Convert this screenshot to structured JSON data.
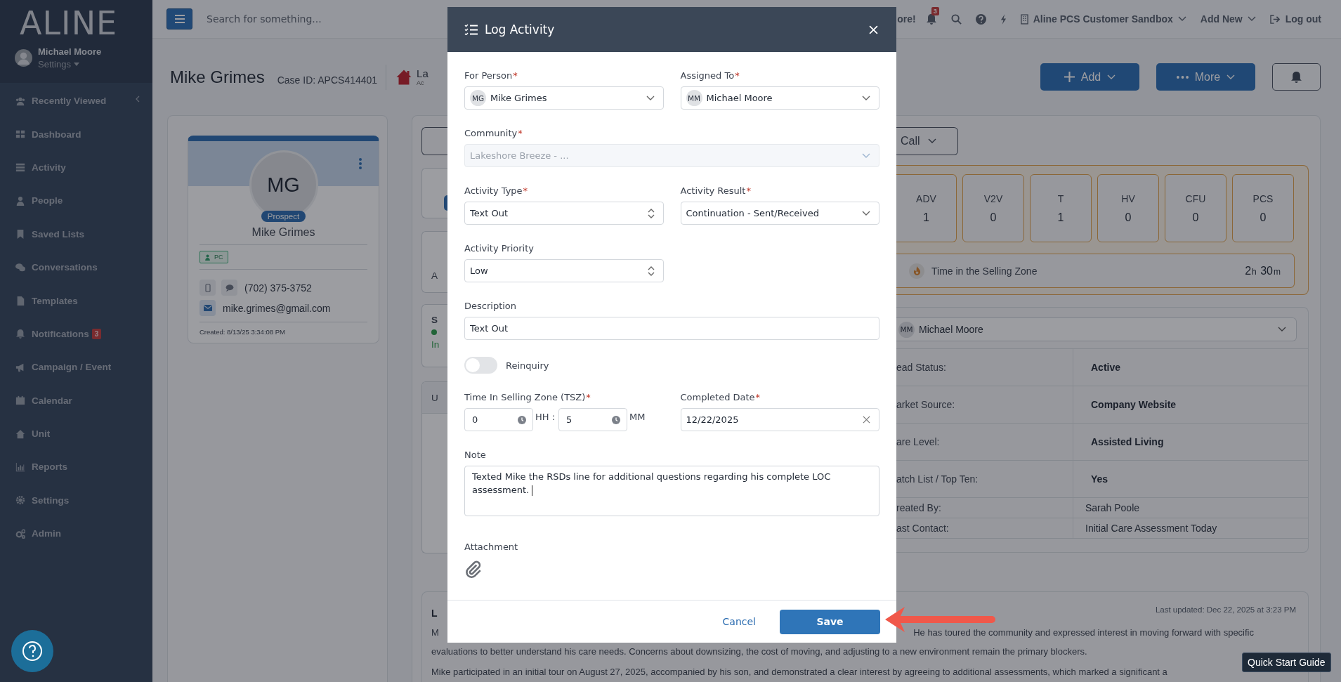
{
  "sidebar": {
    "logo": "ALINE",
    "user": {
      "name": "Michael Moore",
      "settings": "Settings"
    },
    "items": [
      {
        "label": "Recently Viewed"
      },
      {
        "label": "Dashboard"
      },
      {
        "label": "Activity"
      },
      {
        "label": "People"
      },
      {
        "label": "Saved Lists"
      },
      {
        "label": "Conversations"
      },
      {
        "label": "Templates"
      },
      {
        "label": "Notifications",
        "badge": "3"
      },
      {
        "label": "Campaign / Event"
      },
      {
        "label": "Calendar"
      },
      {
        "label": "Unit"
      },
      {
        "label": "Reports"
      },
      {
        "label": "Settings"
      },
      {
        "label": "Admin"
      }
    ]
  },
  "topbar": {
    "search": {
      "placeholder": "Search for something..."
    },
    "promo_fragment": "ore!",
    "notification_badge": "3",
    "account": "Aline PCS Customer Sandbox",
    "add_new": "Add New",
    "logout": "Log out"
  },
  "header": {
    "name": "Mike Grimes",
    "case_id": "Case ID: APCS414401",
    "location_fragment": "La",
    "location_sub_fragment": "Ac",
    "buttons": [
      "Add",
      "More"
    ]
  },
  "profile": {
    "initials": "MG",
    "status": "Prospect",
    "name": "Mike Grimes",
    "tag": "PC",
    "phone": "(702) 375-3752",
    "email": "mike.grimes@gmail.com",
    "created": "Created: 8/13/25 3:34:08 PM"
  },
  "main": {
    "fragments": [
      "A",
      "S",
      "In",
      "U"
    ],
    "call_button": "Call",
    "stats": [
      {
        "label": "ADV",
        "value": "1"
      },
      {
        "label": "V2V",
        "value": "0"
      },
      {
        "label": "T",
        "value": "1"
      },
      {
        "label": "HV",
        "value": "0"
      },
      {
        "label": "CFU",
        "value": "0"
      },
      {
        "label": "PCS",
        "value": "0"
      }
    ],
    "tsz": {
      "label": "Time in the Selling Zone",
      "hours": "2",
      "hours_unit": "h",
      "minutes": "30",
      "minutes_unit": "m"
    },
    "assignee": {
      "initials": "MM",
      "name": "Michael Moore"
    },
    "details": [
      {
        "label": "ead Status:",
        "value": "Active",
        "bold": true
      },
      {
        "label": "arket Source:",
        "value": "Company Website",
        "bold": true
      },
      {
        "label": "are Level:",
        "value": "Assisted Living",
        "bold": true
      },
      {
        "label": "atch List / Top Ten:",
        "value": "Yes",
        "bold": true
      },
      {
        "label": "reated By:",
        "value": "Sarah Poole",
        "bold": false
      },
      {
        "label": "ast Contact:",
        "value": "Initial Care Assessment Today",
        "bold": false
      }
    ],
    "summary": {
      "title_fragment": "L",
      "updated": "Last updated: Dec 22, 2025 at 3:23 PM",
      "line_1_start": "M",
      "line_1_end": "He has toured the community and expressed interest in moving forward with specific",
      "line_2": "evaluations to better understand his care needs. Concerns about downsizing, the cost of moving, and adjusting to a new environment remain the primary blockers.",
      "line_3": "Mike participated in an initial tour on August 27, 2025, accompanied by his son, and demonstrated a clear interest by agreeing to additional assessments, which marked a significant a"
    }
  },
  "modal": {
    "title": "Log Activity",
    "required_mark": "*",
    "for_person": {
      "label": "For Person",
      "required": true,
      "kind": "select",
      "initials": "MG",
      "value": "Mike Grimes"
    },
    "assigned_to": {
      "label": "Assigned To",
      "required": true,
      "kind": "select",
      "initials": "MM",
      "value": "Michael Moore"
    },
    "community": {
      "label": "Community",
      "required": true,
      "kind": "select",
      "value": "Lakeshore Breeze - ...",
      "disabled": true
    },
    "activity_type": {
      "label": "Activity Type",
      "required": true,
      "kind": "spinner",
      "value": "Text Out"
    },
    "activity_result": {
      "label": "Activity Result",
      "required": true,
      "kind": "select",
      "value": "Continuation - Sent/Received"
    },
    "priority": {
      "label": "Activity Priority",
      "required": false,
      "kind": "spinner",
      "value": "Low"
    },
    "description": {
      "label": "Description",
      "required": false,
      "value": "Text Out"
    },
    "reinquiry": {
      "label": "Reinquiry",
      "on": false
    },
    "tsz": {
      "label": "Time In Selling Zone (TSZ)",
      "required": true,
      "hours": "0",
      "hours_unit": "HH :",
      "minutes": "5",
      "minutes_unit": "MM"
    },
    "completed_date": {
      "label": "Completed Date",
      "required": true,
      "value": "12/22/2025"
    },
    "note": {
      "label": "Note",
      "value": "Texted Mike the RSDs line for additional questions regarding his complete LOC assessment."
    },
    "attachment": {
      "label": "Attachment"
    },
    "cancel": "Cancel",
    "save": "Save"
  },
  "quick_start": "Quick Start Guide"
}
